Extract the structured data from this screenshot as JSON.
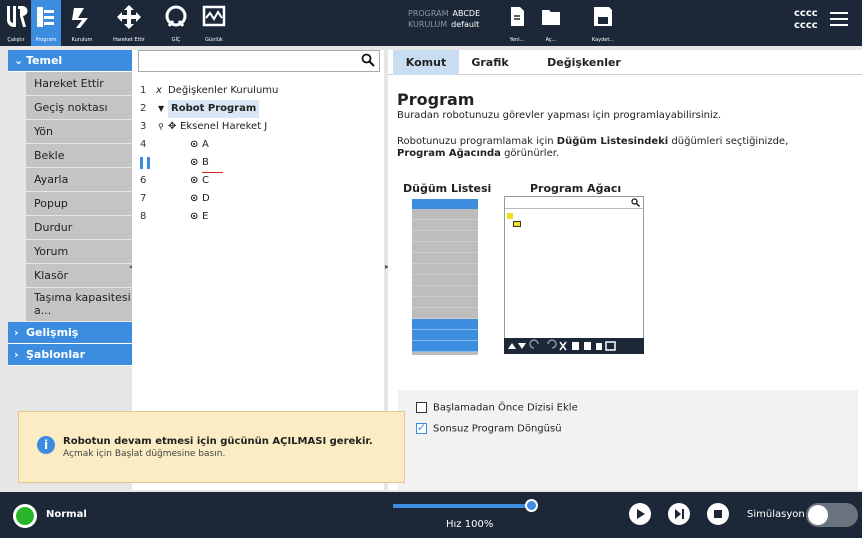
{
  "topbar": {
    "buttons": [
      {
        "label": "Çalıştır",
        "icon": "ur-logo-icon"
      },
      {
        "label": "Program",
        "icon": "program-icon"
      },
      {
        "label": "Kurulum",
        "icon": "installation-icon"
      },
      {
        "label": "Hareket Ettir",
        "icon": "move-icon"
      },
      {
        "label": "GİÇ",
        "icon": "io-icon"
      },
      {
        "label": "Günlük",
        "icon": "log-icon"
      },
      {
        "label": "Yeni...",
        "icon": "new-file-icon"
      },
      {
        "label": "Aç...",
        "icon": "folder-icon"
      },
      {
        "label": "Kaydet...",
        "icon": "save-icon"
      }
    ],
    "program_label": "PROGRAM",
    "program_value": "ABCDE",
    "installation_label": "KURULUM",
    "installation_value": "default",
    "robot_name_1": "cccc",
    "robot_name_2": "cccc",
    "active_color": "#3c8ce0"
  },
  "left_panel": {
    "basic_label": "Temel",
    "items": [
      "Hareket Ettir",
      "Geçiş noktası",
      "Yön",
      "Bekle",
      "Ayarla",
      "Popup",
      "Durdur",
      "Yorum",
      "Klasör",
      "Taşıma kapasitesi a..."
    ],
    "advanced_label": "Gelişmiş",
    "templates_label": "Şablonlar"
  },
  "tree": {
    "rows": [
      {
        "num": "1",
        "text": "Değişkenler Kurulumu"
      },
      {
        "num": "2",
        "text": "Robot Program"
      },
      {
        "num": "3",
        "text": "Eksenel Hareket J"
      },
      {
        "num": "4",
        "text": "A"
      },
      {
        "num": "5",
        "text": "B"
      },
      {
        "num": "6",
        "text": "C"
      },
      {
        "num": "7",
        "text": "D"
      },
      {
        "num": "8",
        "text": "E"
      }
    ]
  },
  "right_panel": {
    "tabs": [
      "Komut",
      "Grafik",
      "Değişkenler"
    ],
    "title": "Program",
    "desc": "Buradan robotunuzu görevler yapması için programlayabilirsiniz.",
    "desc2_a": "Robotunuzu programlamak için ",
    "desc2_b": "Düğüm Listesindeki",
    "desc2_c": " düğümleri seçtiğinizde,",
    "desc3_a": "Program Ağacında",
    "desc3_b": " görünürler.",
    "node_list_title": "Düğüm Listesi",
    "program_tree_title": "Program Ağacı",
    "check1": "Başlamadan Önce Dizisi Ekle",
    "check2": "Sonsuz Program Döngüsü",
    "check1_checked": false,
    "check2_checked": true
  },
  "toast": {
    "title": "Robotun devam etmesi için gücünün AÇILMASI gerekir.",
    "subtitle": "Açmak için Başlat düğmesine basın."
  },
  "bottom": {
    "status": "Normal",
    "speed": "Hız 100%",
    "speed_percent": 100,
    "simulation_label": "Simülasyon",
    "simulation_on": false
  }
}
